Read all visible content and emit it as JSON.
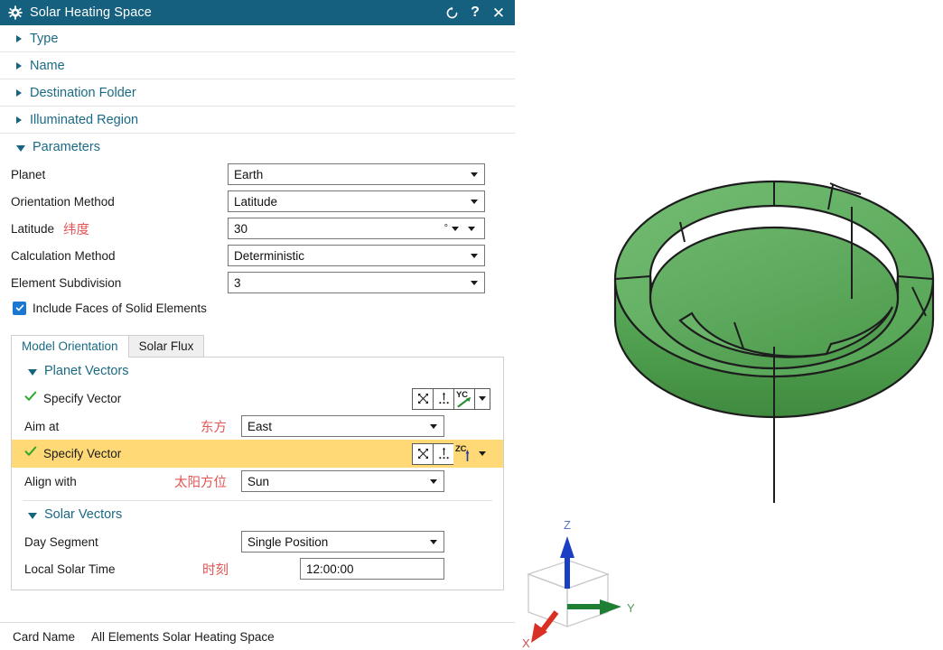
{
  "window": {
    "title": "Solar Heating Space",
    "gear_icon": "gear-icon",
    "reset_icon": "reset-icon",
    "help_icon": "help-icon",
    "close_icon": "close-icon",
    "titlebar_color": "#15607e"
  },
  "collapsed_groups": [
    {
      "label": "Type"
    },
    {
      "label": "Name"
    },
    {
      "label": "Destination Folder"
    },
    {
      "label": "Illuminated Region"
    }
  ],
  "parameters": {
    "section_label": "Parameters",
    "rows": [
      {
        "label": "Planet",
        "annotation": "",
        "value": "Earth",
        "control": "combo"
      },
      {
        "label": "Orientation Method",
        "annotation": "",
        "value": "Latitude",
        "control": "combo"
      },
      {
        "label": "Latitude",
        "annotation": "纬度",
        "value": "30",
        "unit": "°",
        "control": "expression"
      },
      {
        "label": "Calculation Method",
        "annotation": "",
        "value": "Deterministic",
        "control": "combo"
      },
      {
        "label": "Element Subdivision",
        "annotation": "",
        "value": "3",
        "control": "combo"
      }
    ],
    "checkbox": {
      "label": "Include Faces of Solid Elements",
      "checked": true,
      "color": "#1c77d0"
    }
  },
  "tabs": [
    {
      "label": "Model Orientation",
      "active": true
    },
    {
      "label": "Solar Flux",
      "active": false
    }
  ],
  "planet_vectors": {
    "section_label": "Planet Vectors",
    "vector_row_1": {
      "label": "Specify Vector",
      "check_icon": "check-icon",
      "buttons": {
        "inferred_icon": "vector-inferred-icon",
        "points_icon": "vector-points-icon",
        "axis_label": "YC",
        "axis_icon": "yc-axis-arrow-icon",
        "menu_icon": "chevron-down-icon"
      },
      "highlighted": false
    },
    "aim_at": {
      "label": "Aim at",
      "annotation": "东方",
      "value": "East"
    },
    "vector_row_2": {
      "label": "Specify Vector",
      "check_icon": "check-icon",
      "buttons": {
        "inferred_icon": "vector-inferred-icon",
        "points_icon": "vector-points-icon",
        "axis_label": "ZC",
        "axis_icon": "zc-axis-arrow-icon",
        "menu_icon": "chevron-down-icon"
      },
      "highlighted": true,
      "highlight_color": "#ffd976"
    },
    "align_with": {
      "label": "Align with",
      "annotation": "太阳方位",
      "value": "Sun"
    }
  },
  "solar_vectors": {
    "section_label": "Solar Vectors",
    "day_segment": {
      "label": "Day Segment",
      "annotation": "",
      "value": "Single Position"
    },
    "local_solar_time": {
      "label": "Local Solar Time",
      "annotation": "时刻",
      "value": "12:00:00"
    }
  },
  "statusbar": {
    "key": "Card Name",
    "value": "All Elements Solar Heating Space"
  },
  "viewport": {
    "model_name": "green-annular-solid",
    "model_color": "#4fa04f",
    "triad": {
      "x_label": "X",
      "y_label": "Y",
      "z_label": "Z",
      "x_color": "#d93025",
      "y_color": "#1e7e34",
      "z_color": "#1a3fc4"
    }
  }
}
